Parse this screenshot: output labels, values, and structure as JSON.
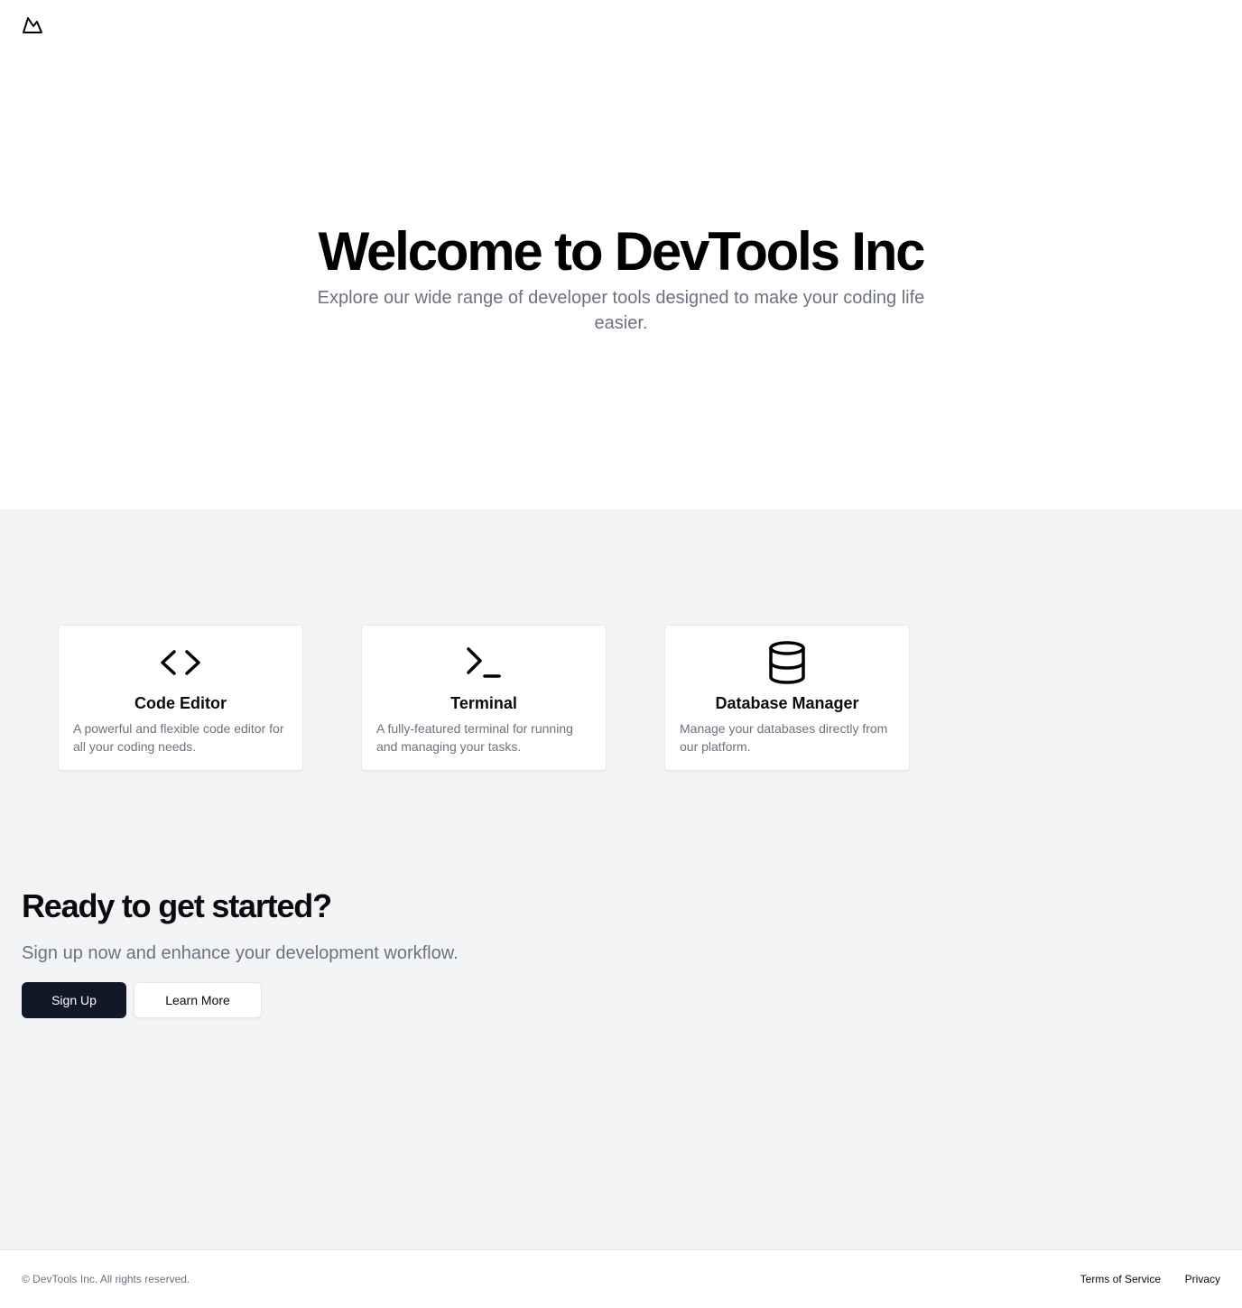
{
  "header": {
    "logo_icon": "mountain-icon"
  },
  "hero": {
    "title": "Welcome to DevTools Inc",
    "subtitle": "Explore our wide range of developer tools designed to make your coding life easier."
  },
  "features": [
    {
      "icon": "code-brackets-icon",
      "title": "Code Editor",
      "description": "A powerful and flexible code editor for all your coding needs."
    },
    {
      "icon": "terminal-prompt-icon",
      "title": "Terminal",
      "description": "A fully-featured terminal for running and managing your tasks."
    },
    {
      "icon": "database-icon",
      "title": "Database Manager",
      "description": "Manage your databases directly from our platform."
    }
  ],
  "cta": {
    "title": "Ready to get started?",
    "subtitle": "Sign up now and enhance your development workflow.",
    "primary_label": "Sign Up",
    "secondary_label": "Learn More"
  },
  "footer": {
    "copyright": "© DevTools Inc. All rights reserved.",
    "links": [
      "Terms of Service",
      "Privacy"
    ]
  },
  "colors": {
    "primary_button": "#111827",
    "section_background": "#f3f4f6",
    "muted_text": "#6b7280"
  }
}
